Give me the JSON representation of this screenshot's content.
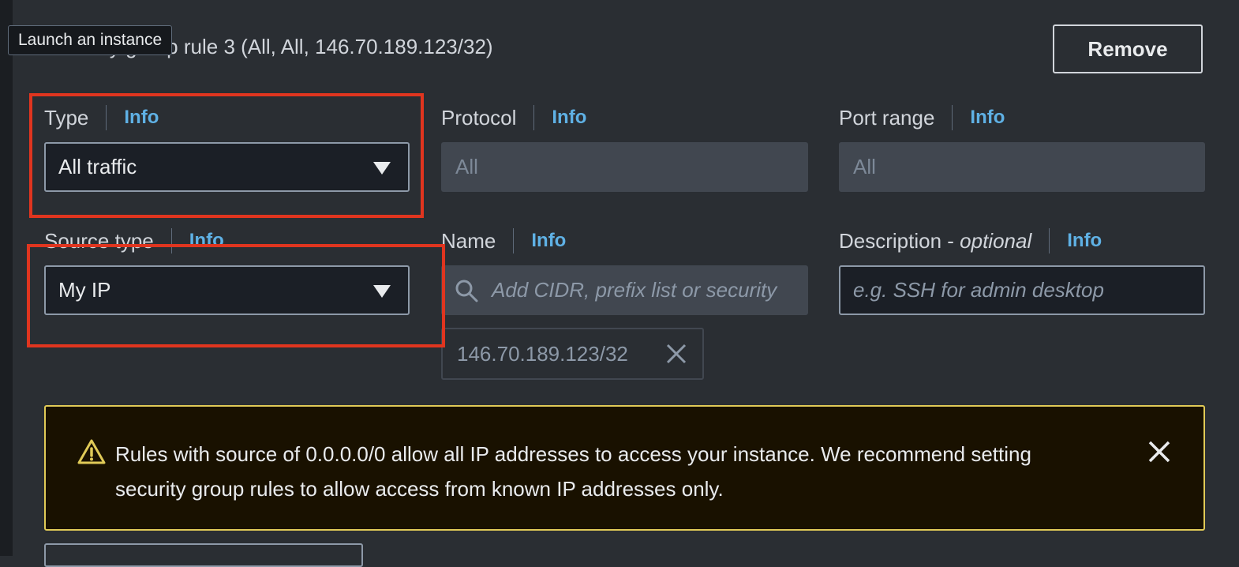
{
  "tooltip": "Launch an instance",
  "rule": {
    "heading": "Security group rule 3 (All, All, 146.70.189.123/32)",
    "remove_label": "Remove"
  },
  "fields": {
    "type": {
      "label": "Type",
      "info": "Info",
      "value": "All traffic"
    },
    "protocol": {
      "label": "Protocol",
      "info": "Info",
      "value": "All"
    },
    "port_range": {
      "label": "Port range",
      "info": "Info",
      "value": "All"
    },
    "source_type": {
      "label": "Source type",
      "info": "Info",
      "value": "My IP"
    },
    "name": {
      "label": "Name",
      "info": "Info",
      "placeholder": "Add CIDR, prefix list or security"
    },
    "description": {
      "label_main": "Description - ",
      "label_optional": "optional",
      "info": "Info",
      "placeholder": "e.g. SSH for admin desktop"
    }
  },
  "source_token": "146.70.189.123/32",
  "alert": {
    "message": "Rules with source of 0.0.0.0/0 allow all IP addresses to access your instance. We recommend setting security group rules to allow access from known IP addresses only."
  },
  "colors": {
    "background": "#2a2e33",
    "info_link": "#5fb1e5",
    "highlight": "#e0351f",
    "alert_border": "#e0ca57",
    "alert_bg": "#191100"
  },
  "icons": [
    "caret-down-icon",
    "search-icon",
    "close-icon",
    "warning-icon"
  ]
}
